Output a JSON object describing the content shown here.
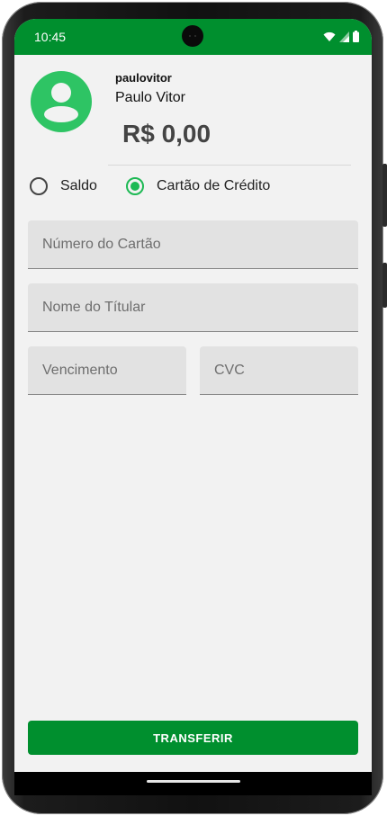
{
  "status_bar": {
    "time": "10:45",
    "icons": [
      "wifi-icon",
      "signal-icon",
      "battery-icon"
    ],
    "color": "#008f2e"
  },
  "profile": {
    "username": "paulovitor",
    "full_name": "Paulo Vitor",
    "balance": "R$ 0,00",
    "avatar_icon": "user-avatar-icon",
    "avatar_color": "#2ec464"
  },
  "payment_method": {
    "options": [
      {
        "label": "Saldo",
        "selected": false
      },
      {
        "label": "Cartão de Crédito",
        "selected": true
      }
    ],
    "accent_color": "#1db954"
  },
  "form": {
    "card_number_placeholder": "Número do Cartão",
    "holder_name_placeholder": "Nome do Títular",
    "expiry_placeholder": "Vencimento",
    "cvc_placeholder": "CVC"
  },
  "actions": {
    "transfer_label": "TRANSFERIR",
    "button_color": "#008f2e"
  }
}
